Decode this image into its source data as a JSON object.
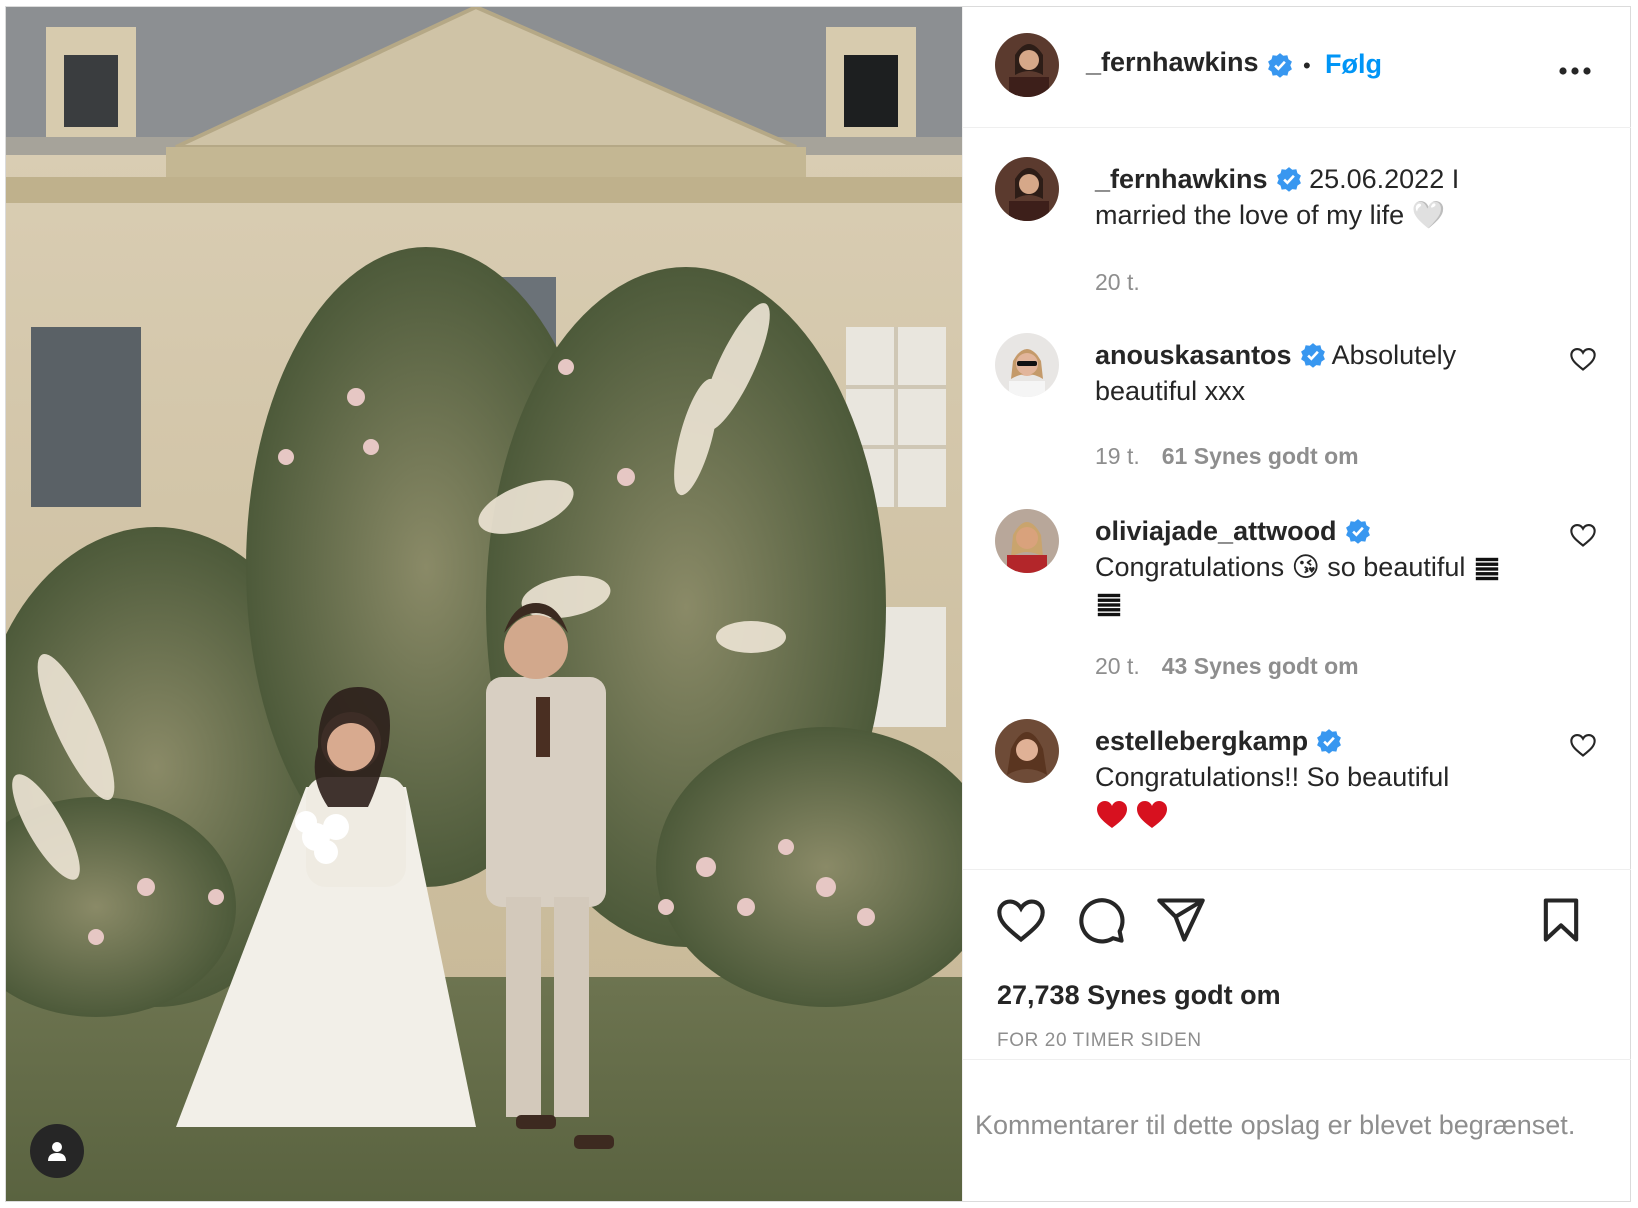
{
  "post": {
    "image_alt": "Wedding couple walking in front of a chateau with a floral arch",
    "user_tag_icon": "person-icon"
  },
  "header": {
    "username": "_fernhawkins",
    "separator": "•",
    "follow_label": "Følg",
    "more_icon": "more-horizontal-icon"
  },
  "caption": {
    "username": "_fernhawkins",
    "text": "25.06.2022 I married the love of my life 🤍",
    "time": "20 t."
  },
  "comments": [
    {
      "username": "anouskasantos",
      "text": "Absolutely beautiful xxx",
      "time": "19 t.",
      "likes": "61 Synes godt om"
    },
    {
      "username": "oliviajade_attwood",
      "text": "Congratulations 😘 so beautiful",
      "time": "20 t.",
      "likes": "43 Synes godt om"
    },
    {
      "username": "estellebergkamp",
      "text": "Congratulations!! So beautiful",
      "time": "",
      "likes": ""
    }
  ],
  "actions": {
    "like_icon": "heart-icon",
    "comment_icon": "comment-icon",
    "share_icon": "send-icon",
    "save_icon": "bookmark-icon"
  },
  "stats": {
    "likes_total": "27,738 Synes godt om",
    "time_ago": "FOR 20 TIMER SIDEN"
  },
  "footer": {
    "restricted_text": "Kommentarer til dette opslag er blevet begrænset."
  },
  "colors": {
    "accent": "#0095f6",
    "verified": "#3897f0",
    "text": "#262626",
    "muted": "#8e8e8e",
    "heart_red": "#e0245e"
  }
}
